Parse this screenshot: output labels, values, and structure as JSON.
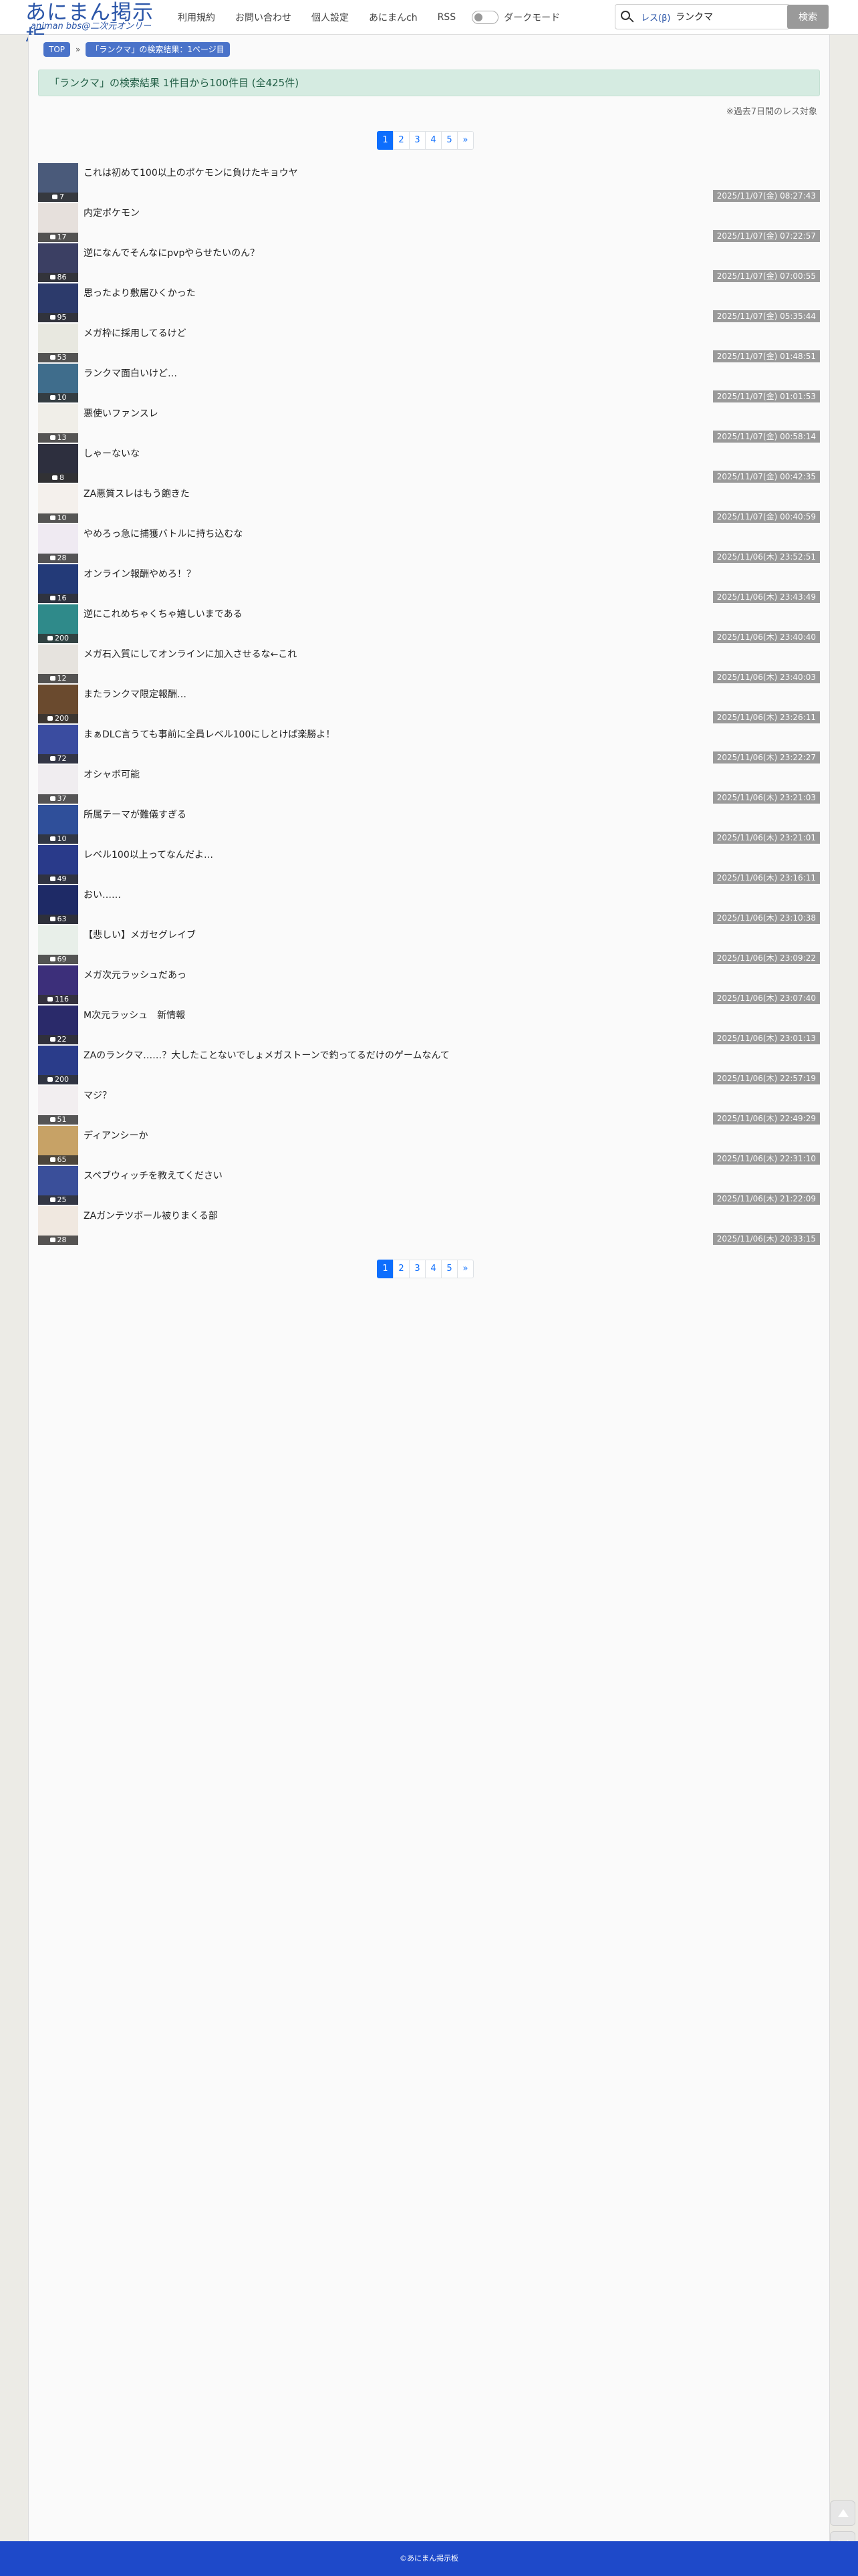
{
  "header": {
    "logo_main": "あにまん掲示板",
    "logo_sub": "animan bbs@二次元オンリー",
    "nav": [
      "利用規約",
      "お問い合わせ",
      "個人設定",
      "あにまんch",
      "RSS"
    ],
    "dark_mode_label": "ダークモード",
    "search_mode": "レス(β)",
    "search_value": "ランクマ",
    "search_button": "検索"
  },
  "breadcrumb": {
    "top": "TOP",
    "separator": "»",
    "current": "「ランクマ」の検索結果：1ページ目"
  },
  "result_header": "「ランクマ」の検索結果 1件目から100件目 (全425件)",
  "scope_note": "※過去7日間のレス対象",
  "pagination": {
    "pages": [
      "1",
      "2",
      "3",
      "4",
      "5"
    ],
    "next": "»",
    "active": "1"
  },
  "threads": [
    {
      "title": "これは初めて100以上のポケモンに負けたキョウヤ",
      "count": "7",
      "date": "2025/11/07(金) 08:27:43",
      "thumb_color": "#4a5a7a"
    },
    {
      "title": "内定ポケモン",
      "count": "17",
      "date": "2025/11/07(金) 07:22:57",
      "thumb_color": "#e6e0dc"
    },
    {
      "title": "逆になんでそんなにpvpやらせたいのん？",
      "count": "86",
      "date": "2025/11/07(金) 07:00:55",
      "thumb_color": "#3b3f63"
    },
    {
      "title": "思ったより敷居ひくかった",
      "count": "95",
      "date": "2025/11/07(金) 05:35:44",
      "thumb_color": "#2c3a6b"
    },
    {
      "title": "メガ枠に採用してるけど",
      "count": "53",
      "date": "2025/11/07(金) 01:48:51",
      "thumb_color": "#e8e8e0"
    },
    {
      "title": "ランクマ面白いけど…",
      "count": "10",
      "date": "2025/11/07(金) 01:01:53",
      "thumb_color": "#3f6d8c"
    },
    {
      "title": "悪使いファンスレ",
      "count": "13",
      "date": "2025/11/07(金) 00:58:14",
      "thumb_color": "#f0eee8"
    },
    {
      "title": "しゃーないな",
      "count": "8",
      "date": "2025/11/07(金) 00:42:35",
      "thumb_color": "#2d2f3e"
    },
    {
      "title": "ZA悪質スレはもう飽きた",
      "count": "10",
      "date": "2025/11/07(金) 00:40:59",
      "thumb_color": "#f4f0ec"
    },
    {
      "title": "やめろっ急に捕獲バトルに持ち込むな",
      "count": "28",
      "date": "2025/11/06(木) 23:52:51",
      "thumb_color": "#efeaf2"
    },
    {
      "title": "オンライン報酬やめろ！？",
      "count": "16",
      "date": "2025/11/06(木) 23:43:49",
      "thumb_color": "#233a78"
    },
    {
      "title": "逆にこれめちゃくちゃ嬉しいまである",
      "count": "200",
      "date": "2025/11/06(木) 23:40:40",
      "thumb_color": "#2f8a8a"
    },
    {
      "title": "メガ石入質にしてオンラインに加入させるな←これ",
      "count": "12",
      "date": "2025/11/06(木) 23:40:03",
      "thumb_color": "#e6e3de"
    },
    {
      "title": "またランクマ限定報酬…",
      "count": "200",
      "date": "2025/11/06(木) 23:26:11",
      "thumb_color": "#6a4a2e"
    },
    {
      "title": "まぁDLC言うても事前に全員レベル100にしとけば楽勝よ！",
      "count": "72",
      "date": "2025/11/06(木) 23:22:27",
      "thumb_color": "#3a4ca0"
    },
    {
      "title": "オシャボ可能",
      "count": "37",
      "date": "2025/11/06(木) 23:21:03",
      "thumb_color": "#f0edf0"
    },
    {
      "title": "所属テーマが難儀すぎる",
      "count": "10",
      "date": "2025/11/06(木) 23:21:01",
      "thumb_color": "#2f4f9a"
    },
    {
      "title": "レベル100以上ってなんだよ…",
      "count": "49",
      "date": "2025/11/06(木) 23:16:11",
      "thumb_color": "#293a8a"
    },
    {
      "title": "おい……",
      "count": "63",
      "date": "2025/11/06(木) 23:10:38",
      "thumb_color": "#1e2a66"
    },
    {
      "title": "【悲しい】メガセグレイブ",
      "count": "69",
      "date": "2025/11/06(木) 23:09:22",
      "thumb_color": "#e8efe9"
    },
    {
      "title": "メガ次元ラッシュだあっ",
      "count": "116",
      "date": "2025/11/06(木) 23:07:40",
      "thumb_color": "#3c2f7a"
    },
    {
      "title": "M次元ラッシュ　新情報",
      "count": "22",
      "date": "2025/11/06(木) 23:01:13",
      "thumb_color": "#2a2a6a"
    },
    {
      "title": "ZAのランクマ……？大したことないでしょメガストーンで釣ってるだけのゲームなんて",
      "count": "200",
      "date": "2025/11/06(木) 22:57:19",
      "thumb_color": "#2a3c8a"
    },
    {
      "title": "マジ？",
      "count": "51",
      "date": "2025/11/06(木) 22:49:29",
      "thumb_color": "#f2eef0"
    },
    {
      "title": "ディアンシーか",
      "count": "65",
      "date": "2025/11/06(木) 22:31:10",
      "thumb_color": "#c7a266"
    },
    {
      "title": "スペブウィッチを教えてください",
      "count": "25",
      "date": "2025/11/06(木) 21:22:09",
      "thumb_color": "#3a4f9a"
    },
    {
      "title": "ZAガンテツボール被りまくる部",
      "count": "28",
      "date": "2025/11/06(木) 20:33:15",
      "thumb_color": "#f0e8e0"
    }
  ],
  "last_thread_count": "37",
  "footer_text": "©あにまん掲示板",
  "colors": {
    "brand_blue": "#2a55a8",
    "pager_active": "#0d6efd",
    "footer": "#1e49c9",
    "result_header_bg": "#d5ebe1"
  },
  "icons": {
    "search": "search-icon",
    "comment": "comment-bubble-icon",
    "scroll_top": "arrow-up-icon",
    "refresh": "refresh-icon"
  }
}
